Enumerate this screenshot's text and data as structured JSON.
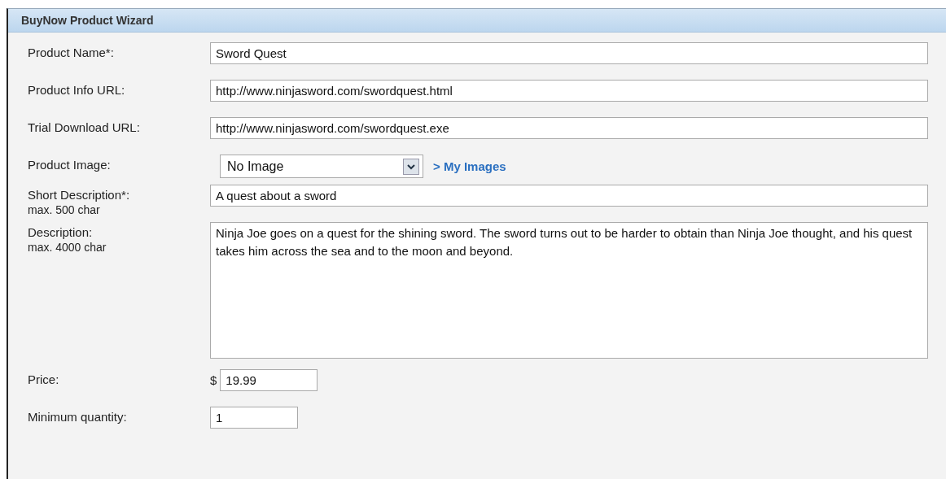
{
  "panel": {
    "title": "BuyNow Product Wizard"
  },
  "fields": [
    {
      "kind": "text",
      "label": "Product Name*:",
      "value": "Sword Quest"
    },
    {
      "kind": "text",
      "label": "Product Info URL:",
      "value": "http://www.ninjasword.com/swordquest.html"
    },
    {
      "kind": "text",
      "label": "Trial Download URL:",
      "value": "http://www.ninjasword.com/swordquest.exe"
    },
    {
      "kind": "select",
      "label": "Product Image:",
      "value": "No Image",
      "link": "> My Images"
    },
    {
      "kind": "text",
      "label": "Short Description*:",
      "hint": "max. 500 char",
      "value": "A quest about a sword"
    },
    {
      "kind": "textarea",
      "label": "Description:",
      "hint": "max. 4000 char",
      "value": "Ninja Joe goes on a quest for the shining sword. The sword turns out to be harder to obtain than Ninja Joe thought, and his quest takes him across the sea and to the moon and beyond."
    },
    {
      "kind": "price",
      "label": "Price:",
      "currency": "$",
      "value": "19.99"
    },
    {
      "kind": "short",
      "label": "Minimum quantity:",
      "value": "1"
    }
  ]
}
